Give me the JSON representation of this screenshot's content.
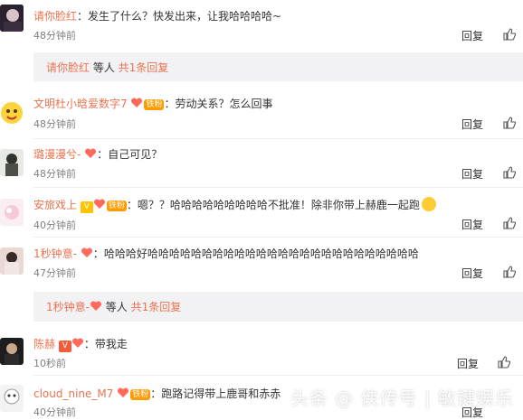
{
  "comments": [
    {
      "user": "请你脸红",
      "text": "发生了什么？快发出来，让我哈哈哈哈~",
      "time": "48分钟前",
      "reply": "回复"
    },
    {
      "user": "文明杜小晗爱数字7",
      "badge": "铁粉",
      "text": "劳动关系？怎么回事",
      "time": "48分钟前",
      "reply": "回复"
    },
    {
      "user": "璐漫漫兮-",
      "text": "自己可见？",
      "time": "48分钟前",
      "reply": "回复"
    },
    {
      "user": "安旅戏上",
      "vip": "V",
      "badge": "铁粉",
      "text": "嗯？？哈哈哈哈哈哈哈哈哈不批准！除非你带上赫鹿一起跑",
      "time": "40分钟前",
      "reply": "回复"
    },
    {
      "user": "1秒钟意-",
      "text": "哈哈哈好哈哈哈哈哈哈哈哈哈哈哈哈哈哈哈哈哈哈哈哈哈哈哈哈哈",
      "time": "47分钟前",
      "reply": "回复"
    },
    {
      "user": "陈赫",
      "vip": "V",
      "text": "带我走",
      "time": "10秒前",
      "reply": "回复"
    },
    {
      "user": "cloud_nine_M7",
      "badge": "铁粉",
      "text": "跑路记得带上鹿哥和赤赤",
      "time": "40分钟前",
      "reply": "回复"
    }
  ],
  "subreplies": [
    {
      "user": "请你脸红",
      "mid": " 等人 ",
      "count": "共1条回复"
    },
    {
      "user": "1秒钟意-",
      "mid": " 等人 ",
      "count": "共1条回复"
    }
  ],
  "watermark": "头条 @ 侠传号 | 敏键娱乐",
  "colors": {
    "username": "#eb7350",
    "text": "#333333",
    "time": "#808080",
    "subbox": "#f2f2f5"
  }
}
